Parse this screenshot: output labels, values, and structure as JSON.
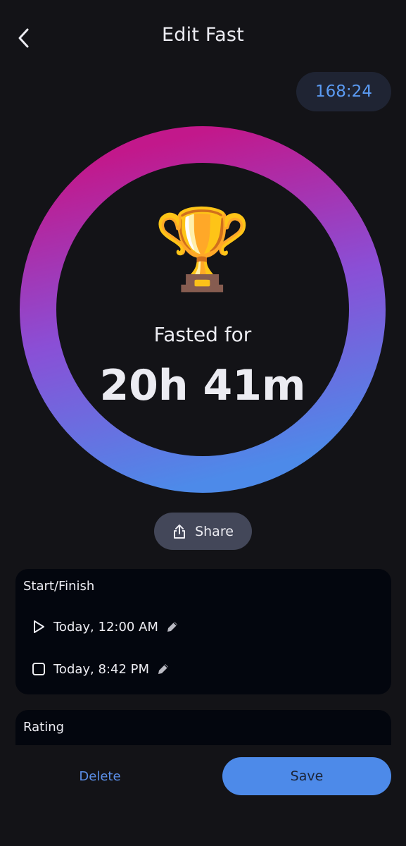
{
  "header": {
    "title": "Edit Fast",
    "back_icon": "chevron-left-icon",
    "timer": "168:24"
  },
  "progress": {
    "fraction": 1.0,
    "gradient": [
      "#c2188b",
      "#8a4fd6",
      "#4d8ae9"
    ]
  },
  "summary": {
    "trophy_icon": "trophy-icon",
    "trophy_glyph": "🏆",
    "label": "Fasted for",
    "value": "20h 41m"
  },
  "share": {
    "label": "Share",
    "icon": "share-icon"
  },
  "start_finish": {
    "title": "Start/Finish",
    "start": {
      "icon": "play-icon",
      "text": "Today, 12:00 AM",
      "edit_icon": "pencil-icon"
    },
    "finish": {
      "icon": "stop-icon",
      "text": "Today, 8:42 PM",
      "edit_icon": "pencil-icon"
    }
  },
  "rating": {
    "title": "Rating"
  },
  "actions": {
    "delete_label": "Delete",
    "save_label": "Save"
  },
  "colors": {
    "background": "#131317",
    "card": "#03060e",
    "accent": "#4d8ae9",
    "timer_text": "#5b9bf3"
  }
}
